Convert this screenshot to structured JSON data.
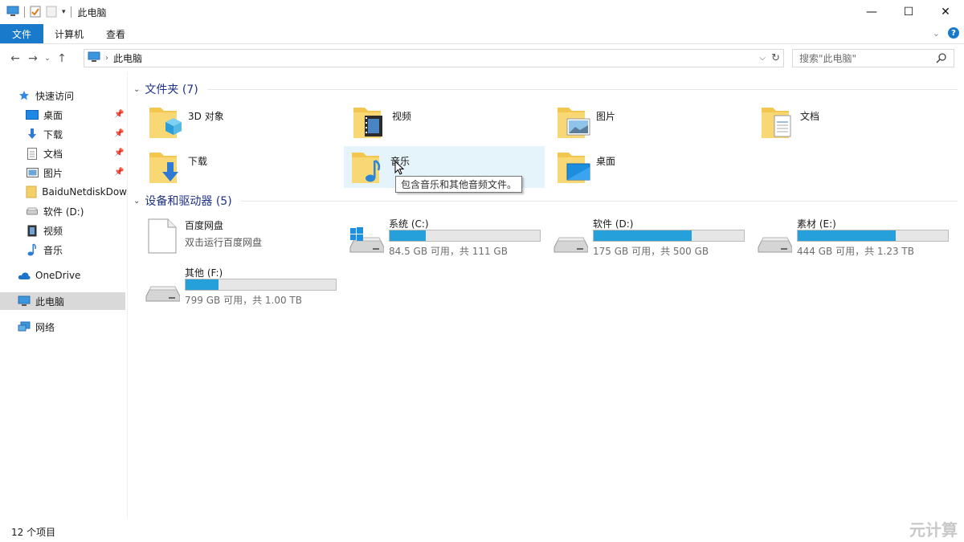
{
  "window": {
    "title": "此电脑",
    "minimize": "—",
    "maximize": "☐",
    "close": "✕"
  },
  "ribbon": {
    "tabs": [
      "文件",
      "计算机",
      "查看"
    ]
  },
  "address": {
    "path": "此电脑",
    "search_placeholder": "搜索\"此电脑\""
  },
  "sidebar": {
    "items": [
      {
        "label": "快速访问",
        "icon": "star-icon",
        "pinned": false
      },
      {
        "label": "桌面",
        "icon": "desktop-icon",
        "pinned": true
      },
      {
        "label": "下载",
        "icon": "download-icon",
        "pinned": true
      },
      {
        "label": "文档",
        "icon": "document-icon",
        "pinned": true
      },
      {
        "label": "图片",
        "icon": "picture-icon",
        "pinned": true
      },
      {
        "label": "BaiduNetdiskDow",
        "icon": "folder-icon",
        "pinned": false
      },
      {
        "label": "软件 (D:)",
        "icon": "drive-icon",
        "pinned": false
      },
      {
        "label": "视频",
        "icon": "video-icon",
        "pinned": false
      },
      {
        "label": "音乐",
        "icon": "music-icon",
        "pinned": false
      },
      {
        "label": "OneDrive",
        "icon": "cloud-icon",
        "pinned": false
      },
      {
        "label": "此电脑",
        "icon": "computer-icon",
        "pinned": false,
        "selected": true
      },
      {
        "label": "网络",
        "icon": "network-icon",
        "pinned": false
      }
    ]
  },
  "folders_group": {
    "header": "文件夹 (7)",
    "items": [
      {
        "name": "3D 对象",
        "icon": "3d-objects-folder-icon"
      },
      {
        "name": "视频",
        "icon": "videos-folder-icon"
      },
      {
        "name": "图片",
        "icon": "pictures-folder-icon"
      },
      {
        "name": "文档",
        "icon": "documents-folder-icon"
      },
      {
        "name": "下载",
        "icon": "downloads-folder-icon"
      },
      {
        "name": "音乐",
        "icon": "music-folder-icon",
        "hover": true
      },
      {
        "name": "桌面",
        "icon": "desktop-folder-icon"
      }
    ]
  },
  "tooltip": "包含音乐和其他音频文件。",
  "drives_group": {
    "header": "设备和驱动器 (5)",
    "items": [
      {
        "name": "百度网盘",
        "subtitle": "双击运行百度网盘",
        "icon": "app-file-icon",
        "bar": false
      },
      {
        "name": "系统 (C:)",
        "subtitle": "84.5 GB 可用，共 111 GB",
        "icon": "windows-drive-icon",
        "bar": true,
        "used_fraction": 0.24
      },
      {
        "name": "软件 (D:)",
        "subtitle": "175 GB 可用，共 500 GB",
        "icon": "drive-icon",
        "bar": true,
        "used_fraction": 0.65
      },
      {
        "name": "素材 (E:)",
        "subtitle": "444 GB 可用，共 1.23 TB",
        "icon": "drive-icon",
        "bar": true,
        "used_fraction": 0.65
      },
      {
        "name": "其他 (F:)",
        "subtitle": "799 GB 可用，共 1.00 TB",
        "icon": "drive-icon",
        "bar": true,
        "used_fraction": 0.22
      }
    ]
  },
  "status": "12 个项目",
  "watermark": "元计算",
  "colors": {
    "accent": "#1979ca",
    "bar_fill": "#26a0da",
    "header_text": "#1e3287",
    "folder": "#f3c64f"
  }
}
